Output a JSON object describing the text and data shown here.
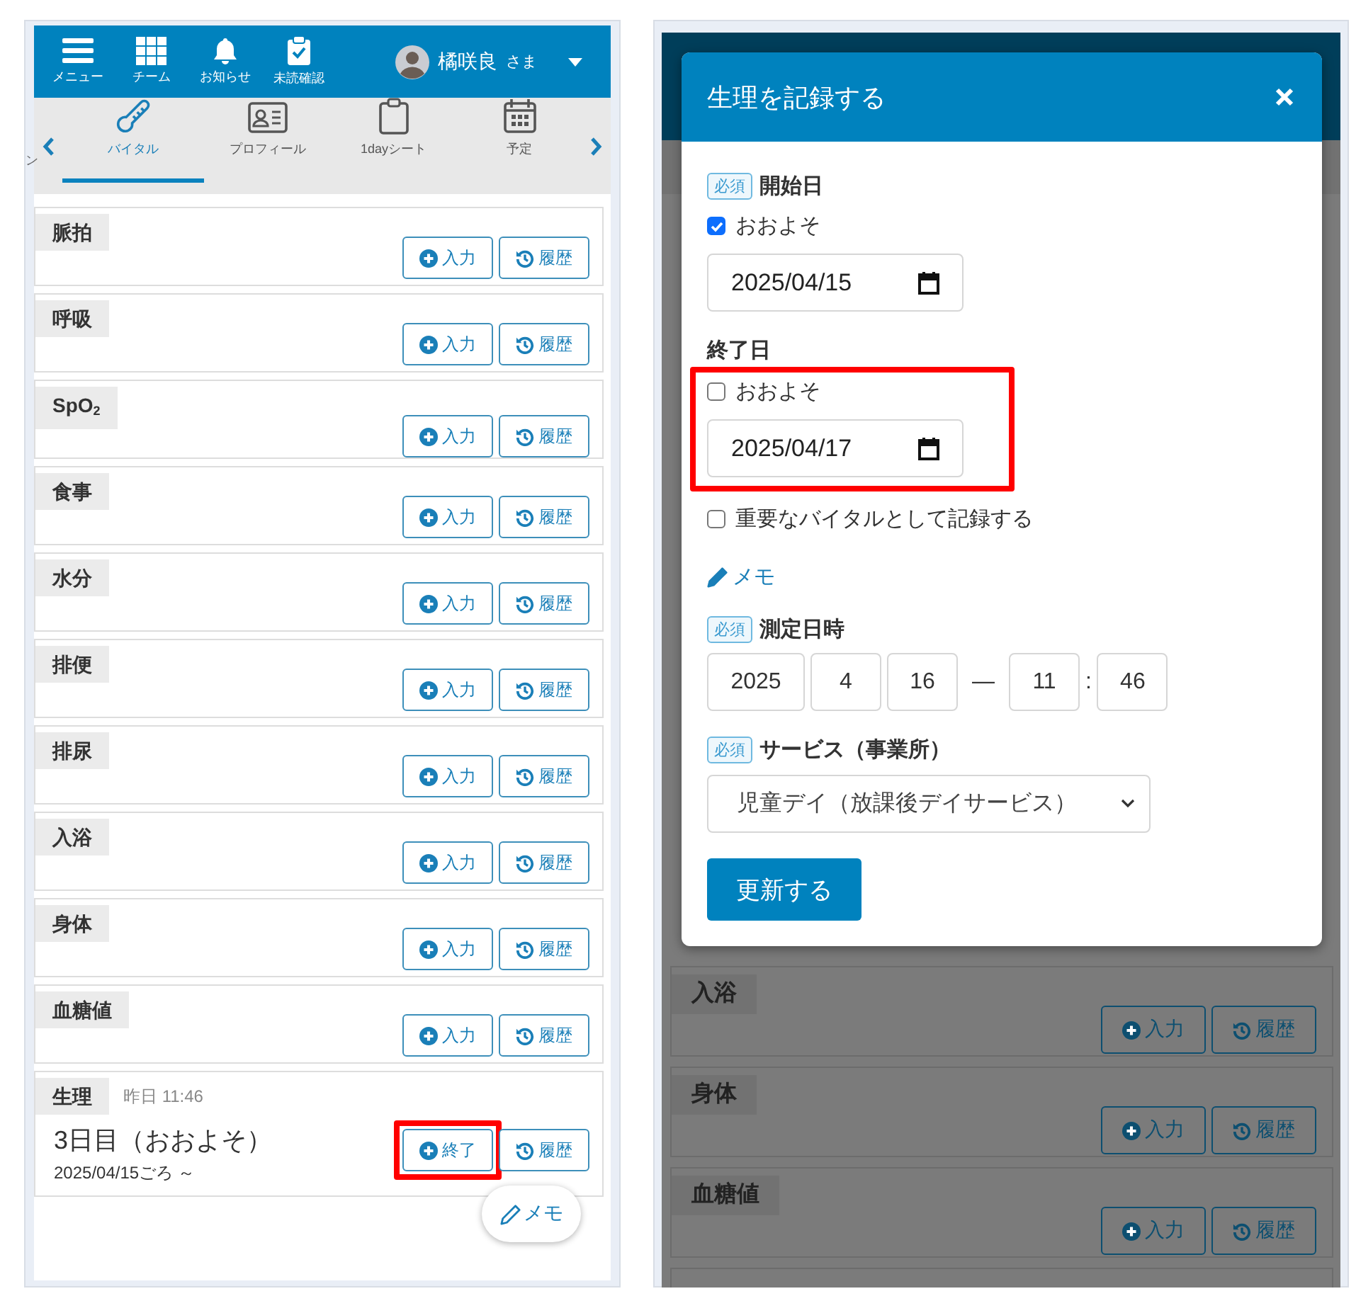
{
  "left_screen": {
    "header": {
      "nav": [
        {
          "label": "メニュー",
          "kind": "menu"
        },
        {
          "label": "チーム",
          "kind": "grid"
        },
        {
          "label": "お知らせ",
          "kind": "bell"
        },
        {
          "label": "未読確認",
          "kind": "clipboard-check"
        }
      ],
      "user": {
        "name": "橘咲良",
        "honorific": "さま"
      }
    },
    "tabs": {
      "partial_label": "ン",
      "items": [
        {
          "label": "バイタル",
          "kind": "thermometer",
          "selected": true
        },
        {
          "label": "プロフィール",
          "kind": "id-card",
          "selected": false
        },
        {
          "label": "1dayシート",
          "kind": "clipboard",
          "selected": false
        },
        {
          "label": "予定",
          "kind": "calendar",
          "selected": false
        }
      ]
    },
    "vitals": [
      {
        "label": "脈拍",
        "buttons": [
          {
            "label": "入力",
            "kind": "add"
          },
          {
            "label": "履歴",
            "kind": "history"
          }
        ]
      },
      {
        "label": "呼吸",
        "buttons": [
          {
            "label": "入力",
            "kind": "add"
          },
          {
            "label": "履歴",
            "kind": "history"
          }
        ]
      },
      {
        "label": "SpO$_{2}$",
        "buttons": [
          {
            "label": "入力",
            "kind": "add"
          },
          {
            "label": "履歴",
            "kind": "history"
          }
        ]
      },
      {
        "label": "食事",
        "buttons": [
          {
            "label": "入力",
            "kind": "add"
          },
          {
            "label": "履歴",
            "kind": "history"
          }
        ]
      },
      {
        "label": "水分",
        "buttons": [
          {
            "label": "入力",
            "kind": "add"
          },
          {
            "label": "履歴",
            "kind": "history"
          }
        ]
      },
      {
        "label": "排便",
        "buttons": [
          {
            "label": "入力",
            "kind": "add"
          },
          {
            "label": "履歴",
            "kind": "history"
          }
        ]
      },
      {
        "label": "排尿",
        "buttons": [
          {
            "label": "入力",
            "kind": "add"
          },
          {
            "label": "履歴",
            "kind": "history"
          }
        ]
      },
      {
        "label": "入浴",
        "buttons": [
          {
            "label": "入力",
            "kind": "add"
          },
          {
            "label": "履歴",
            "kind": "history"
          }
        ]
      },
      {
        "label": "身体",
        "buttons": [
          {
            "label": "入力",
            "kind": "add"
          },
          {
            "label": "履歴",
            "kind": "history"
          }
        ]
      },
      {
        "label": "血糖値",
        "buttons": [
          {
            "label": "入力",
            "kind": "add"
          },
          {
            "label": "履歴",
            "kind": "history"
          }
        ]
      }
    ],
    "period_card": {
      "label": "生理",
      "time": "昨日 11:46",
      "status": "3日目（おおよそ）",
      "since": "2025/04/15ごろ ～",
      "buttons": [
        {
          "label": "終了",
          "kind": "add",
          "highlighted": true
        },
        {
          "label": "履歴",
          "kind": "history",
          "highlighted": false
        }
      ]
    },
    "memo_button": "メモ"
  },
  "right_screen": {
    "background_vitals": [
      {
        "label": "入浴",
        "buttons": [
          {
            "label": "入力",
            "kind": "add"
          },
          {
            "label": "履歴",
            "kind": "history"
          }
        ]
      },
      {
        "label": "身体",
        "buttons": [
          {
            "label": "入力",
            "kind": "add"
          },
          {
            "label": "履歴",
            "kind": "history"
          }
        ]
      },
      {
        "label": "血糖値",
        "buttons": [
          {
            "label": "入力",
            "kind": "add"
          },
          {
            "label": "履歴",
            "kind": "history"
          }
        ]
      }
    ],
    "modal": {
      "title": "生理を記録する",
      "start_date": {
        "required_badge": "必須",
        "label": "開始日",
        "approx": {
          "label": "おおよそ",
          "checked": true
        },
        "value": "2025/04/15"
      },
      "end_date": {
        "label": "終了日",
        "approx": {
          "label": "おおよそ",
          "checked": false
        },
        "value": "2025/04/17",
        "highlighted": true
      },
      "important": {
        "label": "重要なバイタルとして記録する",
        "checked": false
      },
      "memo_link": "メモ",
      "measured": {
        "required_badge": "必須",
        "label": "測定日時",
        "year": "2025",
        "month": "4",
        "day": "16",
        "separator": "—",
        "hour": "11",
        "colon": ":",
        "minute": "46"
      },
      "service": {
        "required_badge": "必須",
        "label": "サービス（事業所）",
        "value": "児童デイ（放課後デイサービス）"
      },
      "submit": "更新する"
    }
  }
}
